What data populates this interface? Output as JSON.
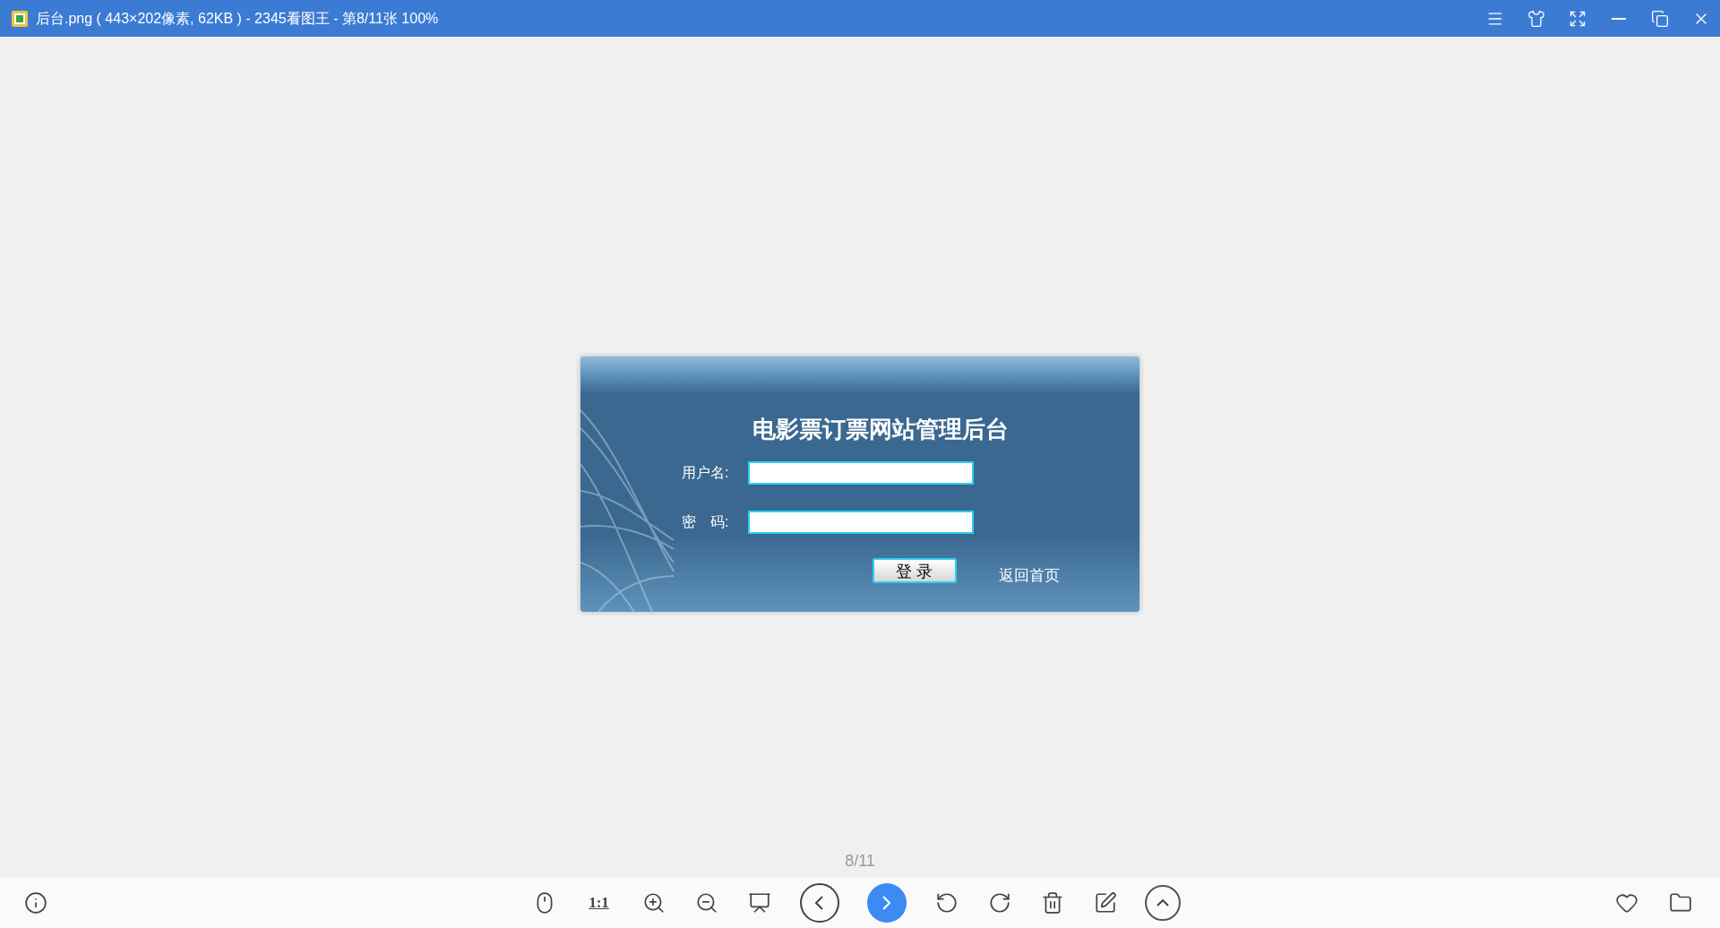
{
  "window": {
    "title": "后台.png ( 443×202像素, 62KB ) - 2345看图王 - 第8/11张 100%",
    "controls": [
      {
        "kind": "menu"
      },
      {
        "kind": "skin"
      },
      {
        "kind": "fullscreen"
      },
      {
        "kind": "minimize"
      },
      {
        "kind": "restore"
      },
      {
        "kind": "close"
      }
    ]
  },
  "image": {
    "title": "电影票订票网站管理后台",
    "fields": [
      {
        "label": "用户名:"
      },
      {
        "label": "密　码:"
      }
    ],
    "login_button": "登 录",
    "home_link": "返回首页"
  },
  "page_counter": "8/11",
  "toolbar": {
    "left": [
      {
        "kind": "info",
        "active": false
      }
    ],
    "center": [
      {
        "kind": "mouse",
        "active": false
      },
      {
        "kind": "ratio",
        "label": "1:1",
        "active": false
      },
      {
        "kind": "zoom-in",
        "active": false
      },
      {
        "kind": "zoom-out",
        "active": false
      },
      {
        "kind": "slideshow",
        "active": false
      },
      {
        "kind": "prev",
        "active": false
      },
      {
        "kind": "next",
        "active": true
      },
      {
        "kind": "rotate-left",
        "active": false
      },
      {
        "kind": "rotate-right",
        "active": false
      },
      {
        "kind": "delete",
        "active": false
      },
      {
        "kind": "edit",
        "active": false
      },
      {
        "kind": "up",
        "active": false
      }
    ],
    "right": [
      {
        "kind": "favorite",
        "active": false
      },
      {
        "kind": "folder",
        "active": false
      }
    ]
  }
}
